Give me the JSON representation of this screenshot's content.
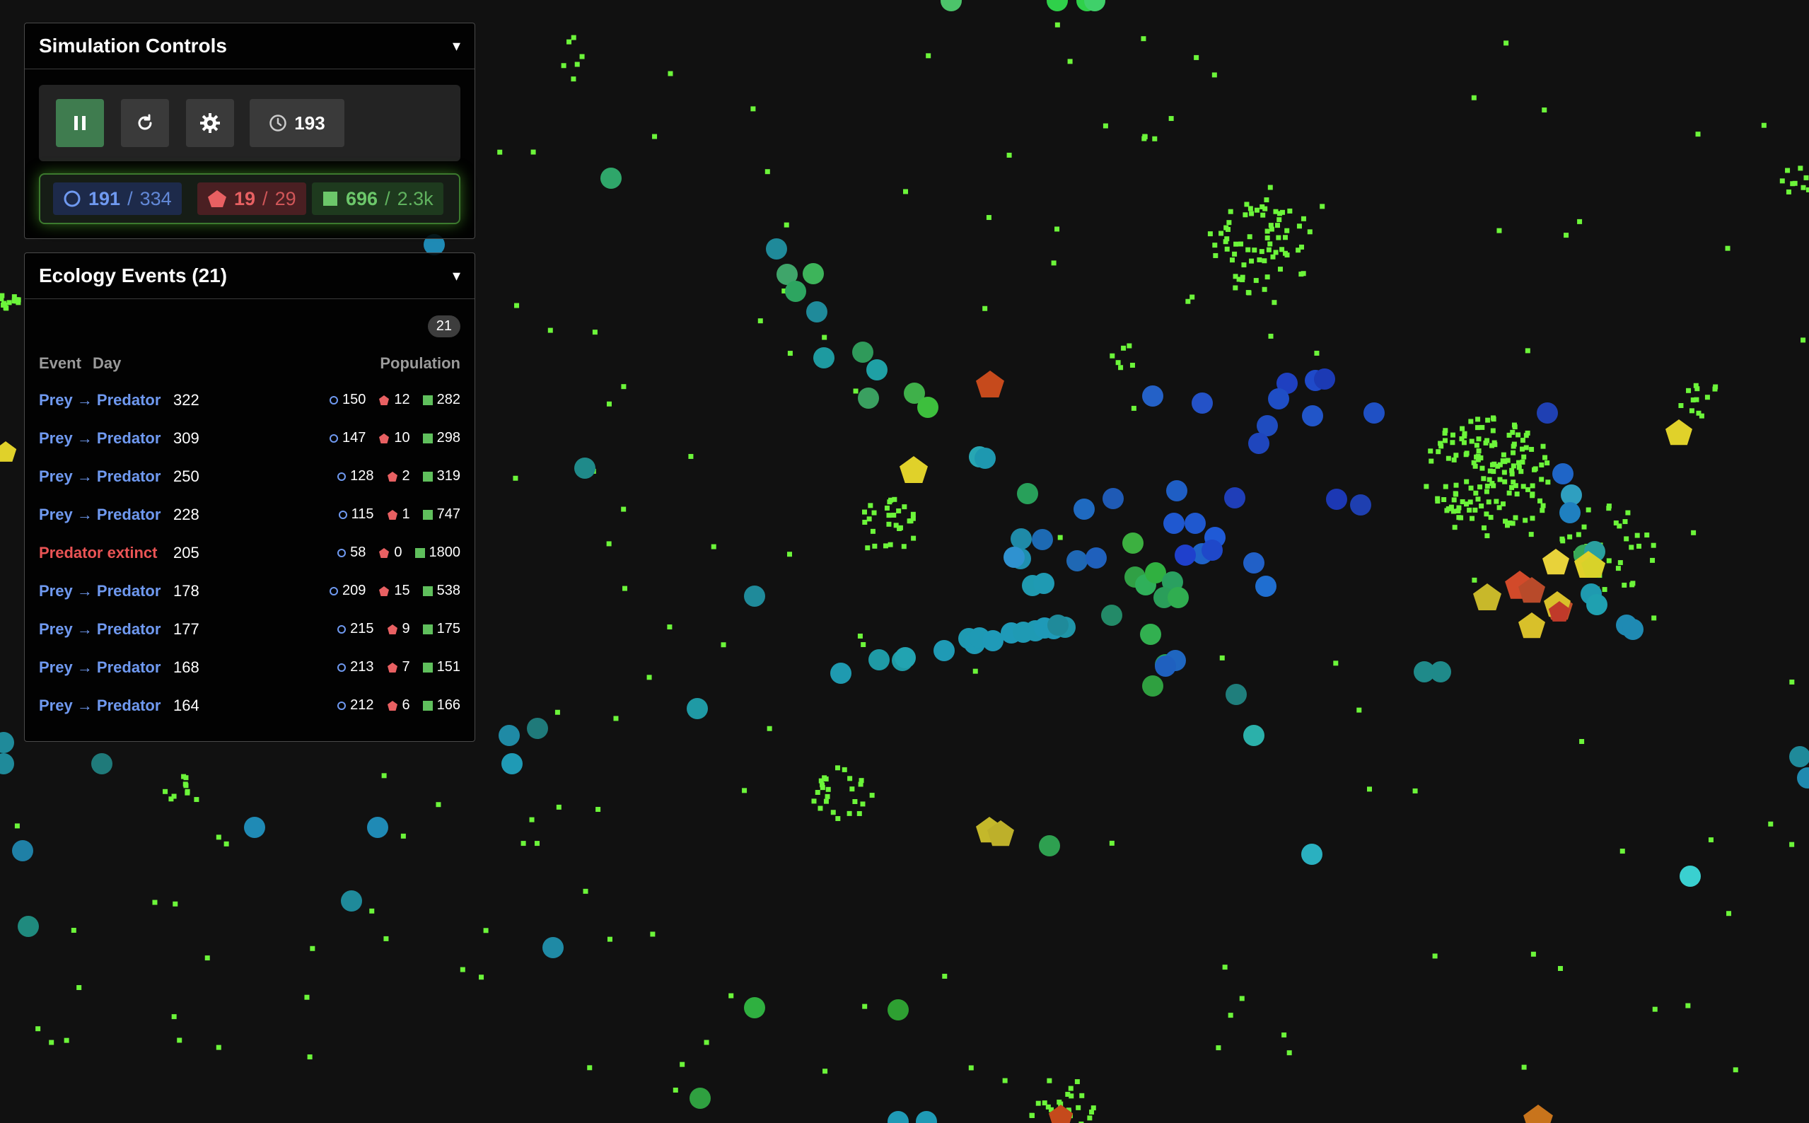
{
  "controls": {
    "title": "Simulation Controls",
    "collapse_glyph": "▾",
    "day_counter": "193",
    "pause_icon": "pause-icon",
    "restart_icon": "restart-icon",
    "settings_icon": "gear-icon",
    "clock_icon": "clock-icon"
  },
  "population": {
    "prey": {
      "current": "191",
      "separator": "/",
      "max": "334",
      "color": "#6f99f0"
    },
    "predator": {
      "current": "19",
      "separator": "/",
      "max": "29",
      "color": "#e86062"
    },
    "plant": {
      "current": "696",
      "separator": "/",
      "max": "2.3k",
      "color": "#6cc76a"
    }
  },
  "events": {
    "title": "Ecology Events (21)",
    "collapse_glyph": "▾",
    "count": "21",
    "columns": {
      "event": "Event",
      "day": "Day",
      "population": "Population"
    },
    "rows": [
      {
        "event": "Prey → Predator",
        "day": "322",
        "prey": "150",
        "predator": "12",
        "plant": "282",
        "type": "conversion"
      },
      {
        "event": "Prey → Predator",
        "day": "309",
        "prey": "147",
        "predator": "10",
        "plant": "298",
        "type": "conversion"
      },
      {
        "event": "Prey → Predator",
        "day": "250",
        "prey": "128",
        "predator": "2",
        "plant": "319",
        "type": "conversion"
      },
      {
        "event": "Prey → Predator",
        "day": "228",
        "prey": "115",
        "predator": "1",
        "plant": "747",
        "type": "conversion"
      },
      {
        "event": "Predator extinct",
        "day": "205",
        "prey": "58",
        "predator": "0",
        "plant": "1800",
        "type": "extinct"
      },
      {
        "event": "Prey → Predator",
        "day": "178",
        "prey": "209",
        "predator": "15",
        "plant": "538",
        "type": "conversion"
      },
      {
        "event": "Prey → Predator",
        "day": "177",
        "prey": "215",
        "predator": "9",
        "plant": "175",
        "type": "conversion"
      },
      {
        "event": "Prey → Predator",
        "day": "168",
        "prey": "213",
        "predator": "7",
        "plant": "151",
        "type": "conversion"
      },
      {
        "event": "Prey → Predator",
        "day": "164",
        "prey": "212",
        "predator": "6",
        "plant": "166",
        "type": "conversion"
      }
    ]
  }
}
